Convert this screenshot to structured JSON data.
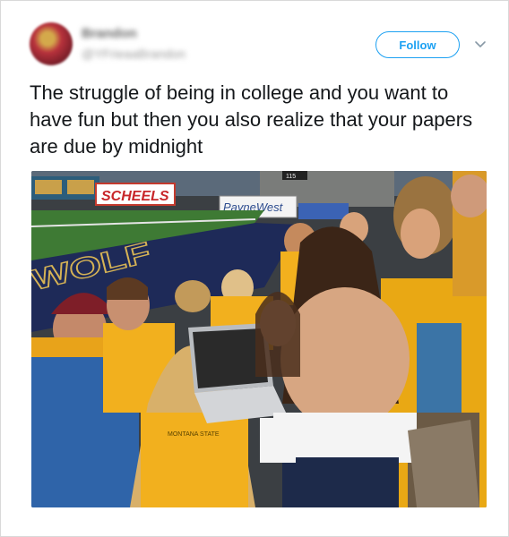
{
  "tweet": {
    "author_name": "Brandon",
    "author_handle": "@YFrieaaBrandon",
    "follow_label": "Follow",
    "text": "The struggle of being in college and you want to have fun but then you also realize that your papers are due by midnight",
    "photo": {
      "banner_text": "SCHEELS",
      "sponsor_text": "PayneWest",
      "scoreboard_text": "115",
      "field_text": "WOLF",
      "shirt_text": "MONTANA STATE"
    }
  },
  "colors": {
    "accent": "#1da1f2",
    "text": "#14171a",
    "gold": "#f2b01e",
    "navy": "#1e2a58"
  },
  "icons": {
    "caret": "chevron-down-icon"
  }
}
